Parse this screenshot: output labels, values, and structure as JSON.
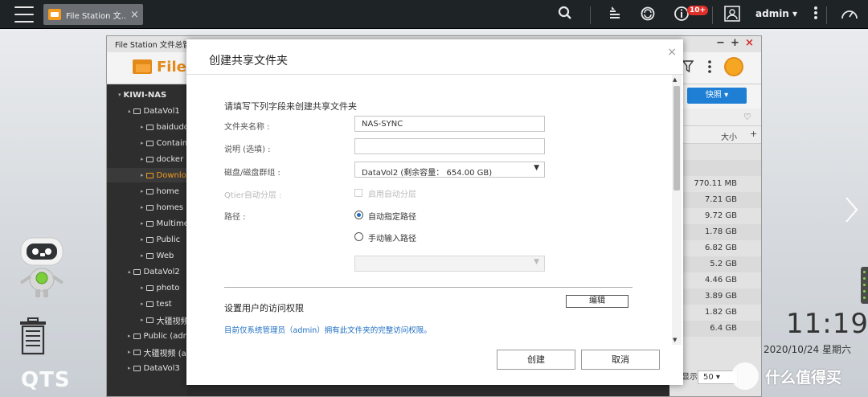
{
  "taskbar": {
    "tab_title": "File Station 文...",
    "notification_count": "10+",
    "user": "admin ▾"
  },
  "filestation": {
    "window_title": "File Station 文件总管",
    "app_name": "File",
    "quick_button": "快照 ▾",
    "size_header": "大小",
    "add_col": "+",
    "tree": [
      {
        "label": "KIWI-NAS",
        "level": 0
      },
      {
        "label": "DataVol1",
        "level": 1
      },
      {
        "label": "baidudo",
        "level": 2
      },
      {
        "label": "Contain",
        "level": 2
      },
      {
        "label": "docker",
        "level": 2
      },
      {
        "label": "Downlo",
        "level": 2,
        "selected": true
      },
      {
        "label": "home",
        "level": 2
      },
      {
        "label": "homes",
        "level": 2
      },
      {
        "label": "Multime",
        "level": 2
      },
      {
        "label": "Public",
        "level": 2
      },
      {
        "label": "Web",
        "level": 2
      },
      {
        "label": "DataVol2",
        "level": 1
      },
      {
        "label": "photo",
        "level": 2
      },
      {
        "label": "test",
        "level": 2
      },
      {
        "label": "大疆视频",
        "level": 2
      },
      {
        "label": "Public (adm",
        "level": 1
      },
      {
        "label": "大疆视频 (ad",
        "level": 1
      },
      {
        "label": "DataVol3",
        "level": 1
      }
    ],
    "sizes": [
      "770.11 MB",
      "7.21 GB",
      "9.72 GB",
      "1.78 GB",
      "6.82 GB",
      "5.2 GB",
      "4.46 GB",
      "3.89 GB",
      "1.82 GB",
      "6.4 GB"
    ],
    "pager_label": "显示",
    "pager_value": "50"
  },
  "dialog": {
    "title": "创建共享文件夹",
    "close": "×",
    "intro": "请填写下列字段来创建共享文件夹",
    "folder_name_label": "文件夹名称 :",
    "folder_name_value": "NAS-SYNC",
    "desc_label": "说明 (选填) :",
    "desc_value": "",
    "disk_label": "磁盘/磁盘群组 :",
    "disk_value": "DataVol2 (剩余容量： 654.00 GB)",
    "qtier_label": "Qtier自动分层 :",
    "qtier_check_label": "启用自动分层",
    "path_label": "路径 :",
    "path_auto": "自动指定路径",
    "path_manual": "手动输入路径",
    "perm_title": "设置用户的访问权限",
    "edit_button": "编辑",
    "perm_note": "目前仅系统管理员（admin）拥有此文件夹的完整访问权限。",
    "create_button": "创建",
    "cancel_button": "取消"
  },
  "desktop": {
    "qts_logo": "QTS",
    "time": "11:19",
    "date": "2020/10/24 星期六",
    "watermark": "什么值得买"
  },
  "colors": {
    "accent_orange": "#e48a19",
    "link_blue": "#1f6fc4",
    "badge_red": "#e0302b",
    "quick_blue": "#1f7fd4"
  }
}
